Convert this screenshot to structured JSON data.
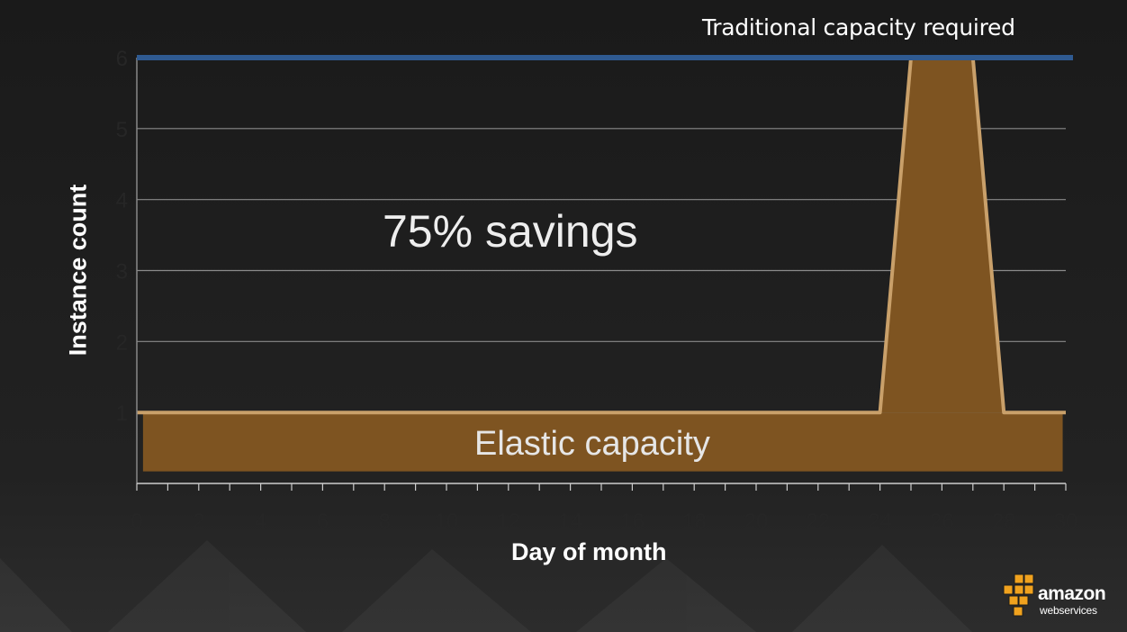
{
  "chart_data": {
    "type": "area",
    "title": "",
    "xlabel": "Day of month",
    "ylabel": "Instance count",
    "xlim": [
      0,
      30
    ],
    "ylim": [
      0,
      6
    ],
    "yticks": [
      1,
      2,
      3,
      4,
      5,
      6
    ],
    "xticks": [
      0,
      2,
      4,
      6,
      8,
      10,
      12,
      14,
      16,
      18,
      20,
      22,
      24,
      26,
      28,
      30
    ],
    "grid": true,
    "traditional_capacity": 6,
    "series": [
      {
        "name": "Elastic capacity",
        "x": [
          0,
          1,
          2,
          3,
          4,
          5,
          6,
          7,
          8,
          9,
          10,
          11,
          12,
          13,
          14,
          15,
          16,
          17,
          18,
          19,
          20,
          21,
          22,
          23,
          24,
          25,
          26,
          27,
          28,
          29,
          30
        ],
        "values": [
          1,
          1,
          1,
          1,
          1,
          1,
          1,
          1,
          1,
          1,
          1,
          1,
          1,
          1,
          1,
          1,
          1,
          1,
          1,
          1,
          1,
          1,
          1,
          1,
          1,
          6,
          6,
          6,
          1,
          1,
          1
        ]
      }
    ]
  },
  "annotations": {
    "traditional": "Traditional capacity required",
    "savings": "75% savings",
    "elastic": "Elastic capacity"
  },
  "colors": {
    "background": "#1c1c1c",
    "traditional_line": "#2f5a91",
    "elastic_fill": "#7e5421",
    "elastic_line": "#c9a06a",
    "grid": "#8a8a8a"
  },
  "logo": {
    "word": "amazon",
    "sub": "webservices"
  }
}
